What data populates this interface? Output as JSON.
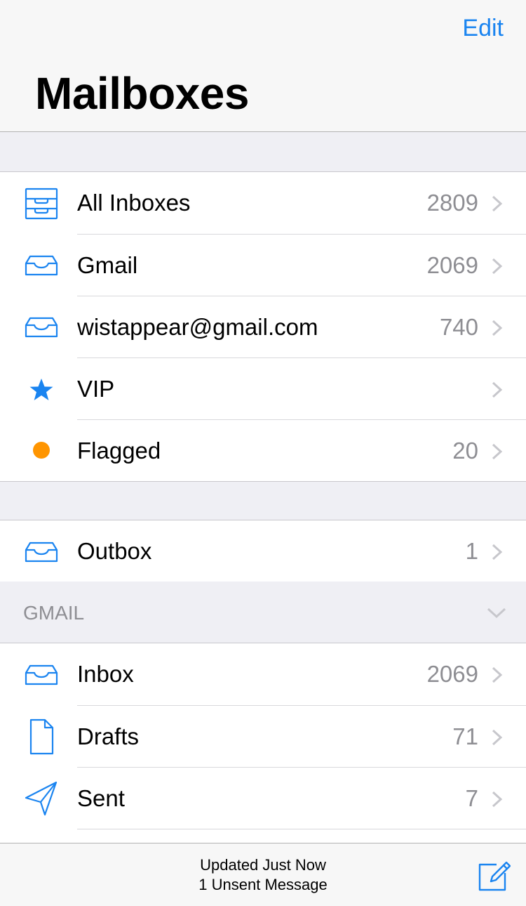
{
  "nav": {
    "edit_label": "Edit",
    "title": "Mailboxes"
  },
  "accent_color": "#1a84f0",
  "flag_color": "#ff9500",
  "groups": {
    "main": [
      {
        "label": "All Inboxes",
        "count": "2809",
        "icon": "all-inboxes-icon"
      },
      {
        "label": "Gmail",
        "count": "2069",
        "icon": "inbox-tray-icon"
      },
      {
        "label": "wistappear@gmail.com",
        "count": "740",
        "icon": "inbox-tray-icon"
      },
      {
        "label": "VIP",
        "count": "",
        "icon": "star-icon"
      },
      {
        "label": "Flagged",
        "count": "20",
        "icon": "flag-dot-icon"
      }
    ],
    "outbox": [
      {
        "label": "Outbox",
        "count": "1",
        "icon": "inbox-tray-icon"
      }
    ],
    "gmail": [
      {
        "label": "Inbox",
        "count": "2069",
        "icon": "inbox-tray-icon"
      },
      {
        "label": "Drafts",
        "count": "71",
        "icon": "document-icon"
      },
      {
        "label": "Sent",
        "count": "7",
        "icon": "paper-plane-icon"
      }
    ]
  },
  "section": {
    "gmail_header": "GMAIL"
  },
  "toolbar": {
    "status_line1": "Updated Just Now",
    "status_line2": "1 Unsent Message"
  }
}
